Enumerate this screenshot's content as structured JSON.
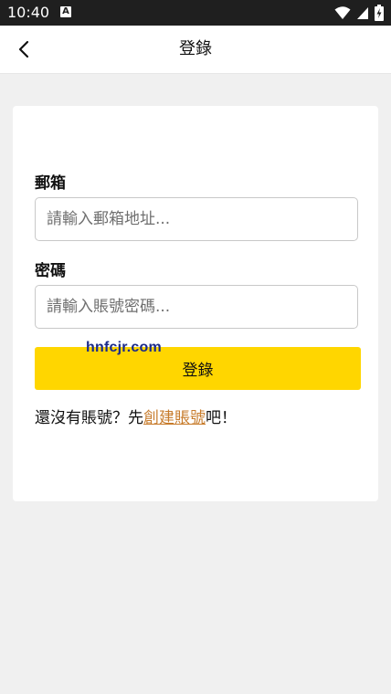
{
  "status_bar": {
    "time": "10:40",
    "notification_letter": "A",
    "icons": [
      "wifi-icon",
      "signal-icon",
      "battery-charging-icon"
    ]
  },
  "header": {
    "title": "登錄",
    "back_icon": "chevron-left-icon"
  },
  "form": {
    "email_label": "郵箱",
    "email_placeholder": "請輸入郵箱地址...",
    "password_label": "密碼",
    "password_placeholder": "請輸入賬號密碼...",
    "login_button_label": "登錄",
    "watermark": "hnfcjr.com",
    "signup_prefix": "還沒有賬號？先",
    "signup_link": "創建賬號",
    "signup_suffix": "吧！"
  },
  "colors": {
    "accent": "#ffd600",
    "link": "#c77b2b",
    "background": "#f0f0f0",
    "status_bar": "#1f1f1f"
  }
}
